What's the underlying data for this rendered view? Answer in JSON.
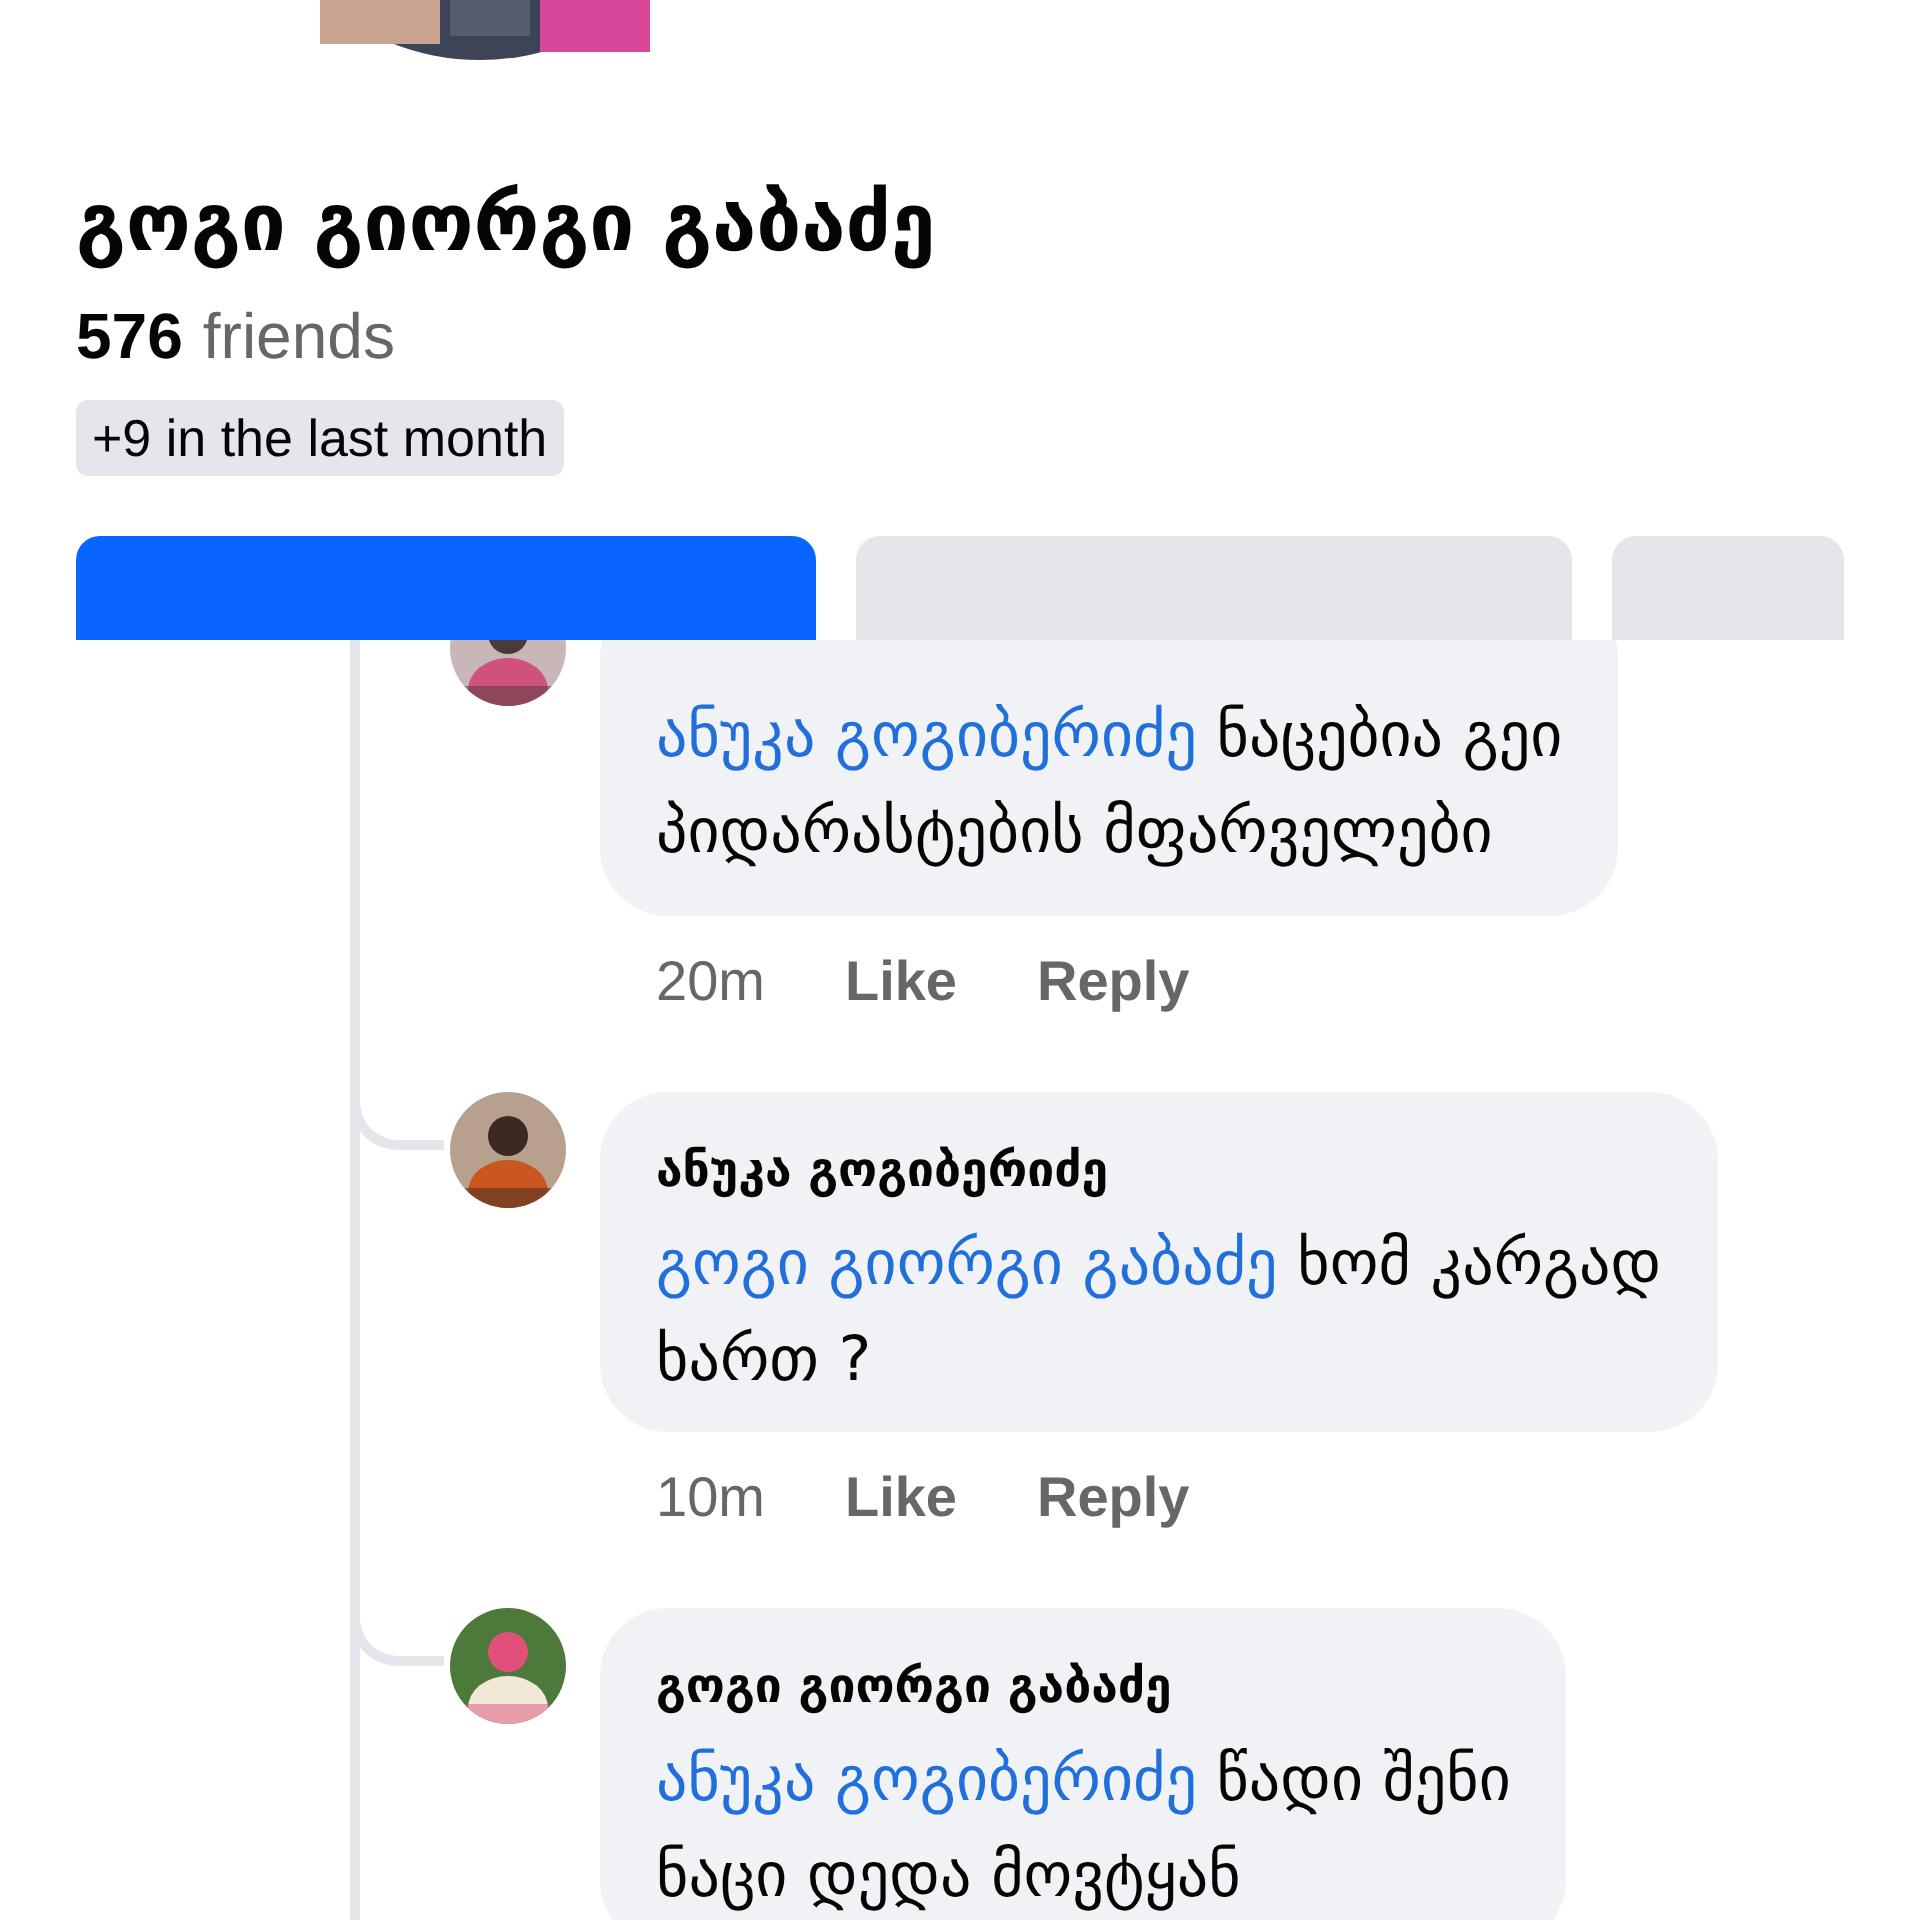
{
  "profile": {
    "name": "გოგი გიორგი გაბაძე",
    "friends_count": "576",
    "friends_label": "friends",
    "recent": "+9 in the last month"
  },
  "buttons": [
    {
      "kind": "primary"
    },
    {
      "kind": "secondary"
    },
    {
      "kind": "more"
    }
  ],
  "comments": [
    {
      "mention": "ანუკა გოგიბერიძე",
      "lines": [
        "ნაცებია გეი",
        "პიდარასტების მფარველები"
      ],
      "time": "20m",
      "actions": [
        "Like",
        "Reply"
      ]
    },
    {
      "author": "ანუკა გოგიბერიძე",
      "mention": "გოგი გიორგი გაბაძე",
      "lines": [
        "ხომ კარგად",
        "ხართ ?"
      ],
      "time": "10m",
      "actions": [
        "Like",
        "Reply"
      ]
    },
    {
      "author": "გოგი გიორგი გაბაძე",
      "mention": "ანუკა გოგიბერიძე",
      "lines": [
        "წადი შენი",
        "ნაცი დედა მოვტყან"
      ]
    }
  ]
}
